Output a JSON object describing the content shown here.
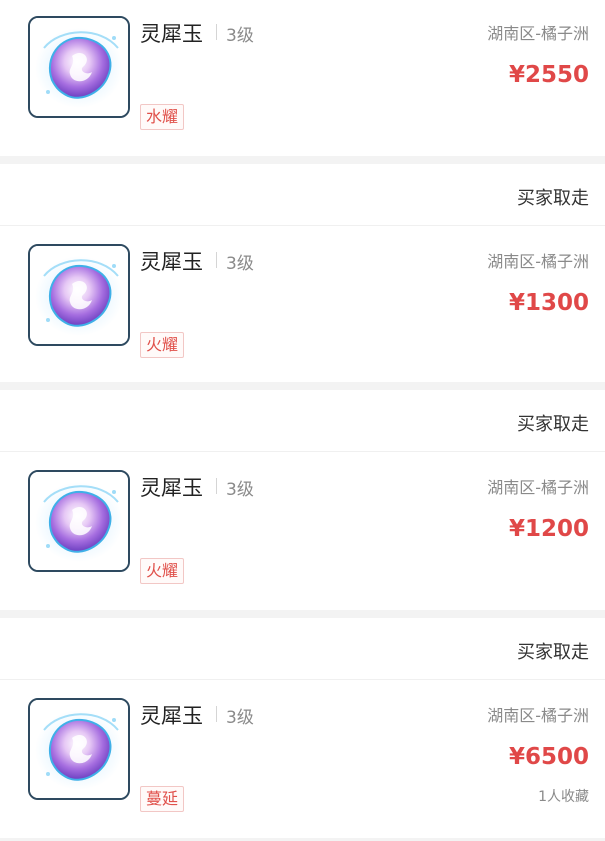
{
  "listings": [
    {
      "status": "",
      "item_name": "灵犀玉",
      "level": "3级",
      "tag": "水耀",
      "location": "湖南区-橘子洲",
      "price": "¥2550",
      "favorites": "",
      "icon": "spirit-jade-icon"
    },
    {
      "status": "买家取走",
      "item_name": "灵犀玉",
      "level": "3级",
      "tag": "火耀",
      "location": "湖南区-橘子洲",
      "price": "¥1300",
      "favorites": "",
      "icon": "spirit-jade-icon"
    },
    {
      "status": "买家取走",
      "item_name": "灵犀玉",
      "level": "3级",
      "tag": "火耀",
      "location": "湖南区-橘子洲",
      "price": "¥1200",
      "favorites": "",
      "icon": "spirit-jade-icon"
    },
    {
      "status": "买家取走",
      "item_name": "灵犀玉",
      "level": "3级",
      "tag": "蔓延",
      "location": "湖南区-橘子洲",
      "price": "¥6500",
      "favorites": "1人收藏",
      "icon": "spirit-jade-icon"
    }
  ],
  "colors": {
    "price": "#e04848",
    "tag_text": "#e0504a",
    "tag_border": "#f2c7c5",
    "thumb_border": "#2e4a60",
    "divider": "#f3f3f3",
    "muted_text": "#8a8a8a"
  }
}
